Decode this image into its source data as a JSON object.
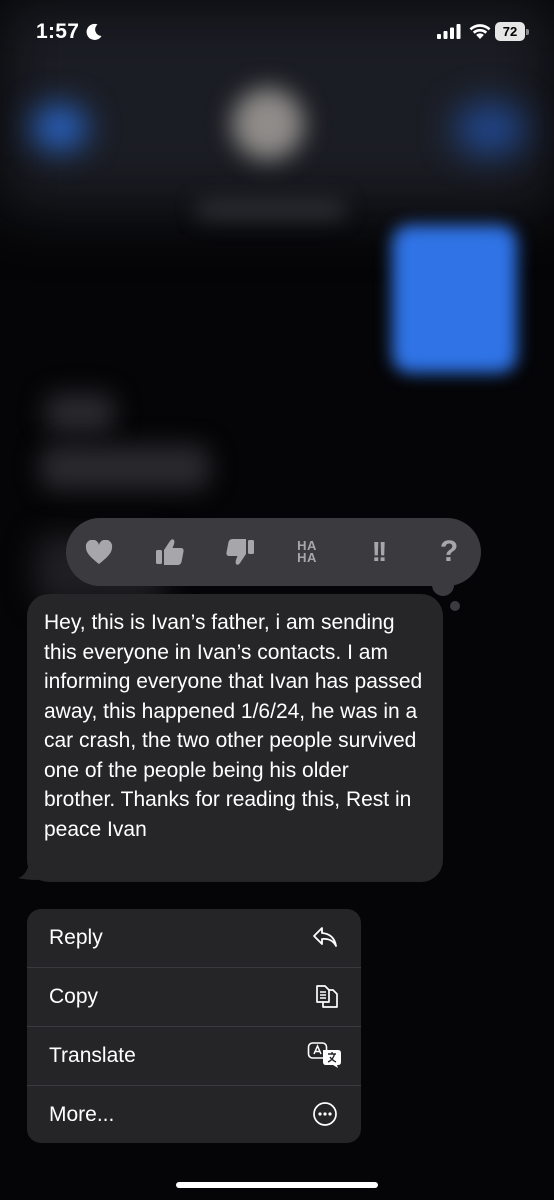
{
  "status_bar": {
    "time": "1:57",
    "battery": "72"
  },
  "tapbacks": [
    "heart",
    "thumbs-up",
    "thumbs-down",
    "haha",
    "exclamation",
    "question"
  ],
  "tapback_text": {
    "ha_top": "HA",
    "ha_bottom": "HA",
    "exclamation": "!!",
    "question": "?"
  },
  "message": {
    "text": "Hey, this is Ivan’s father, i am sending this everyone in Ivan’s contacts. I am informing everyone that Ivan has passed away, this happened 1/6/24, he was in a car crash, the two other people survived one of the people being his older brother. Thanks for reading this, Rest in peace Ivan"
  },
  "menu": {
    "items": [
      {
        "label": "Reply",
        "icon": "reply-icon"
      },
      {
        "label": "Copy",
        "icon": "copy-icon"
      },
      {
        "label": "Translate",
        "icon": "translate-icon"
      },
      {
        "label": "More...",
        "icon": "more-icon"
      }
    ]
  },
  "colors": {
    "background": "#050507",
    "bubble": "#262629",
    "tapback_bar": "#3b3b3f",
    "menu": "#252528",
    "icon_grey": "#a6a6ab"
  }
}
